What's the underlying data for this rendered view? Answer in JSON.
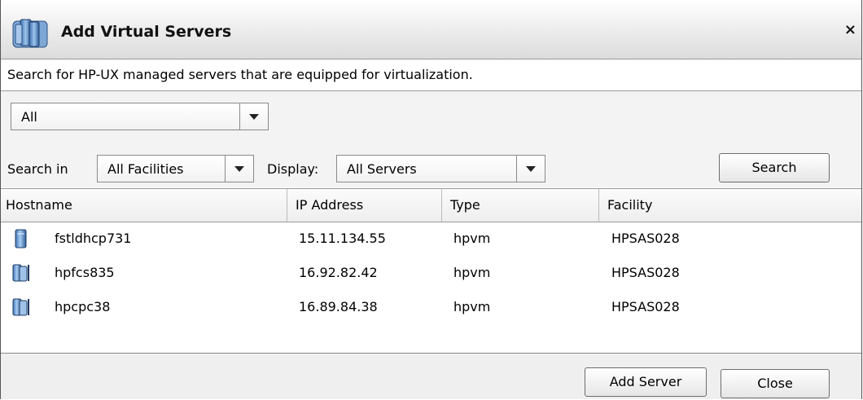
{
  "dialog": {
    "title": "Add Virtual Servers",
    "close_label": "×",
    "title_icon": "virtual-server-icon",
    "description": "Search for HP-UX managed servers that are equipped for virtualization."
  },
  "filters": {
    "scope_select_value": "All",
    "search_in_label": "Search in",
    "facility_select_value": "All Facilities",
    "display_label": "Display:",
    "display_select_value": "All Servers",
    "search_button": "Search"
  },
  "table": {
    "columns": [
      "Hostname",
      "IP Address",
      "Type",
      "Facility"
    ],
    "rows": [
      {
        "icon": "server-icon",
        "hostname": "fstldhcp731",
        "ip": "15.11.134.55",
        "type": "hpvm",
        "facility": "HPSAS028"
      },
      {
        "icon": "server-cluster-icon",
        "hostname": "hpfcs835",
        "ip": "16.92.82.42",
        "type": "hpvm",
        "facility": "HPSAS028"
      },
      {
        "icon": "server-cluster-icon",
        "hostname": "hpcpc38",
        "ip": "16.89.84.38",
        "type": "hpvm",
        "facility": "HPSAS028"
      }
    ]
  },
  "footer": {
    "add_server_button": "Add Server",
    "close_button": "Close"
  }
}
